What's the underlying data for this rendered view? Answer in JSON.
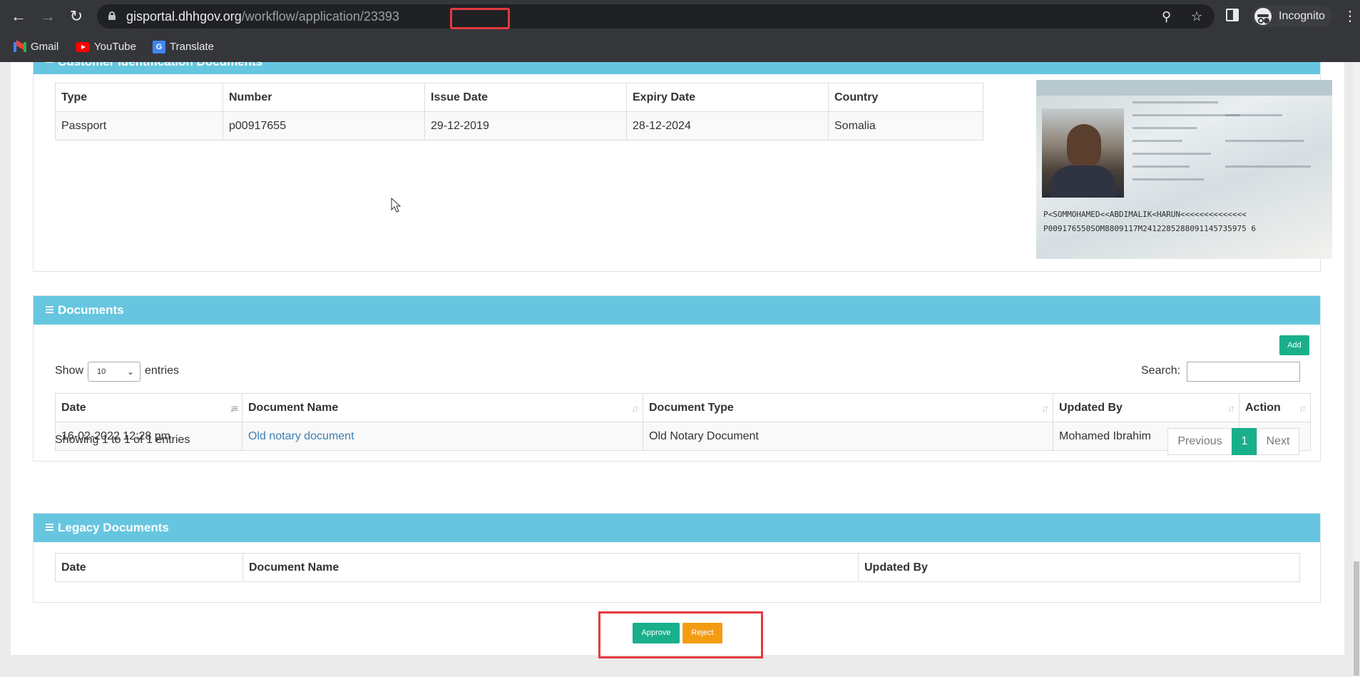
{
  "browser": {
    "url_domain": "gisportal.dhhgov.org",
    "url_path": "/workflow/application/23393",
    "profile_label": "Incognito",
    "bookmarks": [
      {
        "label": "Gmail",
        "icon": "gmail-icon"
      },
      {
        "label": "YouTube",
        "icon": "youtube-icon"
      },
      {
        "label": "Translate",
        "icon": "translate-icon"
      }
    ]
  },
  "customer_docs": {
    "title": "Customer Identification Documents",
    "headers": [
      "Type",
      "Number",
      "Issue Date",
      "Expiry Date",
      "Country"
    ],
    "rows": [
      [
        "Passport",
        "p00917655",
        "29-12-2019",
        "28-12-2024",
        "Somalia"
      ]
    ],
    "passport_image": {
      "mrz_line1": "P<SOMMOHAMED<<ABDIMALIK<HARUN<<<<<<<<<<<<<<",
      "mrz_line2": "P009176550SOM8809117M2412285288091145735975 6"
    }
  },
  "documents": {
    "title": "Documents",
    "add_label": "Add",
    "show_label": "Show",
    "entries_label": "entries",
    "page_size": "10",
    "search_label": "Search:",
    "search_value": "",
    "headers": [
      "Date",
      "Document Name",
      "Document Type",
      "Updated By",
      "Action"
    ],
    "rows": [
      {
        "date": "16-02-2022 12:28 pm",
        "name": "Old notary document",
        "type": "Old Notary Document",
        "updated_by": "Mohamed Ibrahim",
        "action": ""
      }
    ],
    "info": "Showing 1 to 1 of 1 entries",
    "pagination": {
      "previous": "Previous",
      "current": "1",
      "next": "Next"
    }
  },
  "legacy": {
    "title": "Legacy Documents",
    "headers": [
      "Date",
      "Document Name",
      "Updated By"
    ]
  },
  "actions": {
    "approve": "Approve",
    "reject": "Reject"
  },
  "colors": {
    "panel_header": "#67c6df",
    "approve": "#1aaf8b",
    "reject": "#f39c12",
    "highlight": "#e5393f"
  }
}
